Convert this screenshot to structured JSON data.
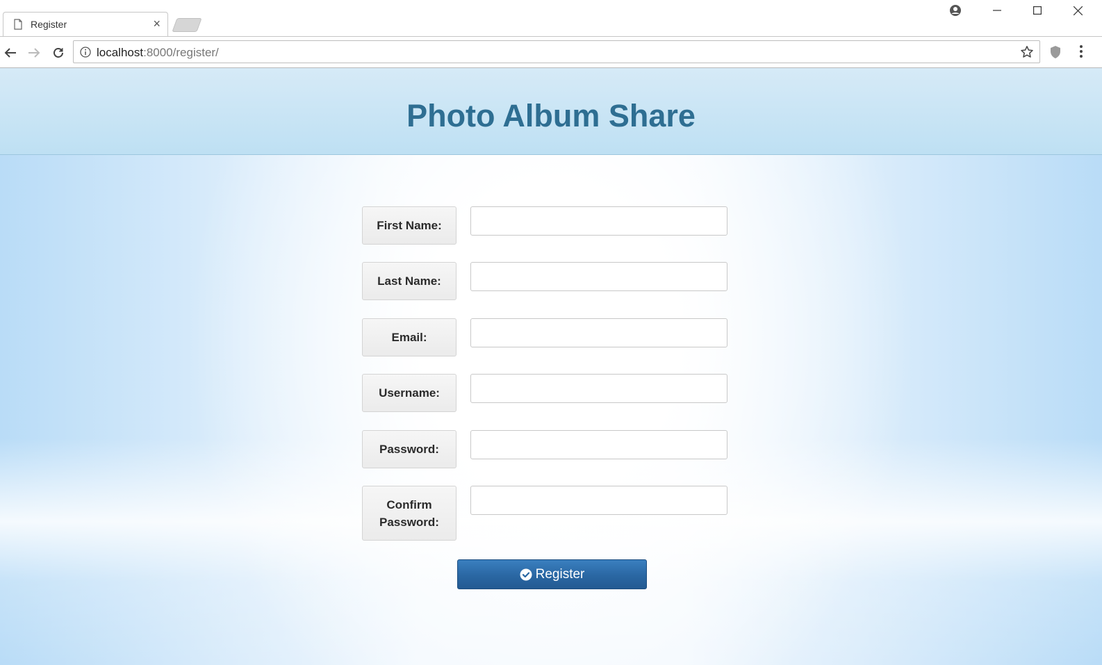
{
  "browser": {
    "tab": {
      "title": "Register",
      "close_glyph": "×"
    },
    "address": {
      "host": "localhost",
      "rest": ":8000/register/"
    },
    "icons": [
      "page-icon",
      "profile-icon",
      "minimize-icon",
      "maximize-icon",
      "close-icon",
      "back-arrow-icon",
      "forward-arrow-icon",
      "reload-icon",
      "info-icon",
      "star-icon",
      "shield-icon",
      "menu-icon"
    ]
  },
  "page": {
    "site_title": "Photo Album Share",
    "form": {
      "fields": [
        {
          "label": "First Name:",
          "value": ""
        },
        {
          "label": "Last Name:",
          "value": ""
        },
        {
          "label": "Email:",
          "value": ""
        },
        {
          "label": "Username:",
          "value": ""
        },
        {
          "label": "Password:",
          "value": ""
        },
        {
          "label_line1": "Confirm",
          "label_line2": "Password:",
          "value": ""
        }
      ],
      "submit_label": "Register",
      "submit_icon": "check-circle-icon"
    },
    "colors": {
      "title": "#2e6e92",
      "button": "#2a67a3",
      "background_edge": "#b9dcf7"
    }
  }
}
